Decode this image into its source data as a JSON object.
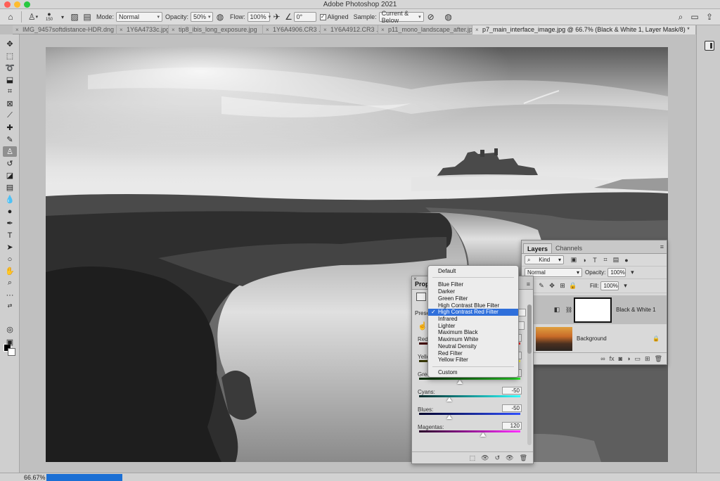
{
  "app": {
    "title": "Adobe Photoshop 2021"
  },
  "options_bar": {
    "brush_size": "150",
    "mode_label": "Mode:",
    "mode_value": "Normal",
    "opacity_label": "Opacity:",
    "opacity_value": "50%",
    "flow_label": "Flow:",
    "flow_value": "100%",
    "angle_value": "0°",
    "aligned_label": "Aligned",
    "sample_label": "Sample:",
    "sample_value": "Current & Below"
  },
  "tabs": [
    {
      "label": "IMG_9457softdistance-HDR.dng"
    },
    {
      "label": "1Y6A4733c.jpg..."
    },
    {
      "label": "tip8_ibis_long_exposure.jpg"
    },
    {
      "label": "1Y6A4906.CR3 ..."
    },
    {
      "label": "1Y6A4912.CR3 ..."
    },
    {
      "label": "p11_mono_landscape_after.jpg"
    },
    {
      "label": "p7_main_interface_image.jpg @ 66.7% (Black & White 1, Layer Mask/8) *"
    }
  ],
  "layers_panel": {
    "tabs": [
      "Layers",
      "Channels"
    ],
    "filter_value": "Kind",
    "blend_value": "Normal",
    "opacity_label": "Opacity:",
    "opacity_value": "100%",
    "fill_label": "Fill:",
    "fill_value": "100%",
    "layers": [
      {
        "name": "Black & White 1"
      },
      {
        "name": "Background"
      }
    ]
  },
  "properties_panel": {
    "title": "Prope",
    "preset_label": "Prese",
    "sliders": [
      {
        "label": "Reds",
        "value": "",
        "level": 0.5
      },
      {
        "label": "Yello",
        "value": "",
        "level": 0.5
      },
      {
        "label": "Gree",
        "value": "",
        "level": 0.4
      },
      {
        "label": "Cyans:",
        "value": "-50",
        "level": 0.3
      },
      {
        "label": "Blues:",
        "value": "-50",
        "level": 0.3
      },
      {
        "label": "Magentas:",
        "value": "120",
        "level": 0.63
      }
    ]
  },
  "preset_dropdown": {
    "items": [
      {
        "label": "Default"
      },
      {
        "label": "Blue Filter"
      },
      {
        "label": "Darker"
      },
      {
        "label": "Green Filter"
      },
      {
        "label": "High Contrast Blue Filter"
      },
      {
        "label": "High Contrast Red Filter",
        "selected": true
      },
      {
        "label": "Infrared"
      },
      {
        "label": "Lighter"
      },
      {
        "label": "Maximum Black"
      },
      {
        "label": "Maximum White"
      },
      {
        "label": "Neutral Density"
      },
      {
        "label": "Red Filter"
      },
      {
        "label": "Yellow Filter"
      },
      {
        "label": "Custom"
      }
    ],
    "check_glyph": "✓"
  },
  "status_bar": {
    "zoom": "66.67%",
    "progress": 0.2
  },
  "colors": {
    "accent": "#2f6fdb",
    "progress": "#1b6fd4",
    "close": "#ff5f57",
    "minimize": "#febc2e",
    "maximize": "#28c840"
  }
}
